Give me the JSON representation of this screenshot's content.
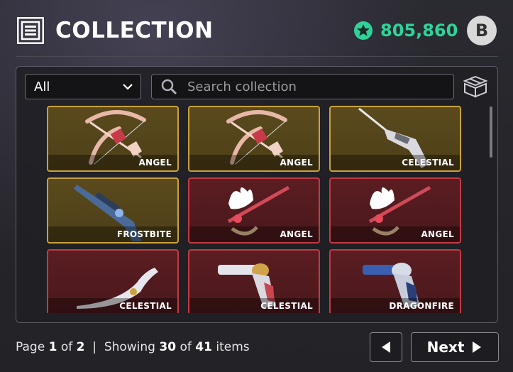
{
  "header": {
    "title": "COLLECTION",
    "currency_amount": "805,860",
    "avatar_letter": "B"
  },
  "filter": {
    "selected": "All",
    "search_placeholder": "Search collection"
  },
  "items": [
    {
      "name": "ANGEL",
      "rarity": "gold",
      "art": "bow"
    },
    {
      "name": "ANGEL",
      "rarity": "gold",
      "art": "bow"
    },
    {
      "name": "CELESTIAL",
      "rarity": "gold",
      "art": "rifle"
    },
    {
      "name": "FROSTBITE",
      "rarity": "gold",
      "art": "sniper"
    },
    {
      "name": "ANGEL",
      "rarity": "red",
      "art": "staff"
    },
    {
      "name": "ANGEL",
      "rarity": "red",
      "art": "staff"
    },
    {
      "name": "CELESTIAL",
      "rarity": "red",
      "art": "knife"
    },
    {
      "name": "CELESTIAL",
      "rarity": "red",
      "art": "revolver"
    },
    {
      "name": "DRAGONFIRE",
      "rarity": "red",
      "art": "revolver-blue"
    }
  ],
  "footer": {
    "page_word": "Page",
    "page_current": "1",
    "of_word": "of",
    "page_total": "2",
    "separator": "|",
    "showing_word": "Showing",
    "showing_count": "30",
    "items_word": "items",
    "total_items": "41",
    "next_label": "Next"
  },
  "colors": {
    "accent": "#2fd39a",
    "gold_border": "#c9a23b",
    "red_border": "#c23b43"
  }
}
